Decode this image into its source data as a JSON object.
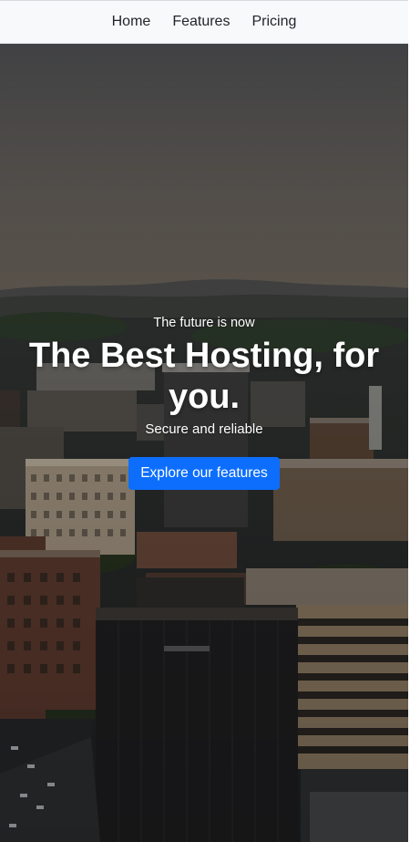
{
  "nav": {
    "items": [
      {
        "label": "Home"
      },
      {
        "label": "Features"
      },
      {
        "label": "Pricing"
      }
    ]
  },
  "hero": {
    "tagline": "The future is now",
    "headline": "The Best Hosting, for you.",
    "subline": "Secure and reliable",
    "cta_label": "Explore our features",
    "background_icon": "city-skyline-photo"
  },
  "colors": {
    "navbar_bg": "#f8f9fa",
    "nav_text": "#212529",
    "cta_bg": "#0d6efd",
    "hero_text": "#ffffff"
  }
}
